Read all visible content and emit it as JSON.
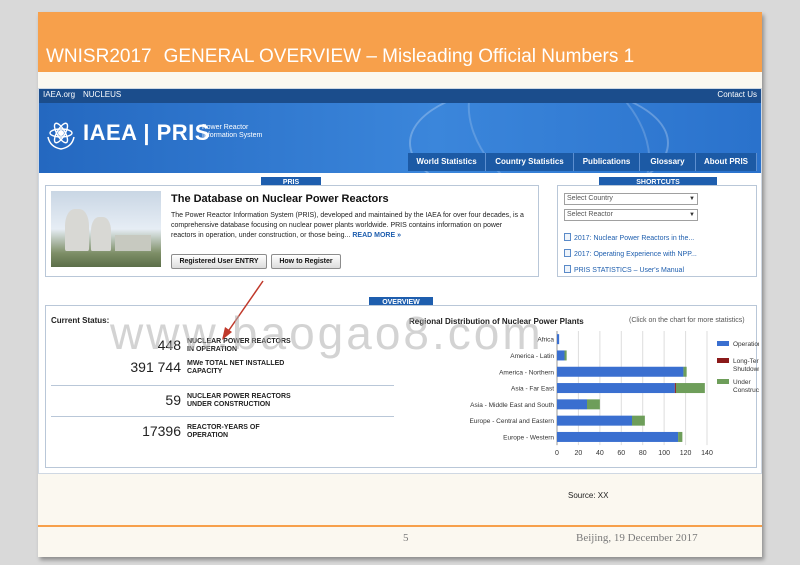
{
  "slide": {
    "code": "WNISR2017",
    "title": "GENERAL OVERVIEW – Misleading Official Numbers 1",
    "source": "Source: XX",
    "page": "5",
    "footer": "Beijing, 19 December 2017",
    "watermark": "www.baogao8.com",
    "accent_color": "#f7a04b"
  },
  "site": {
    "topnav": {
      "left1": "IAEA.org",
      "left2": "NUCLEUS",
      "right": "Contact Us"
    },
    "logo": {
      "text": "IAEA | PRIS",
      "subtitle": "Power Reactor Information System",
      "icon": "iaea-emblem-icon"
    },
    "menu": [
      "World Statistics",
      "Country Statistics",
      "Publications",
      "Glossary",
      "About PRIS"
    ],
    "brand_color": "#1e5eae"
  },
  "pris_panel": {
    "tab": "PRIS",
    "title": "The Database on Nuclear Power Reactors",
    "description": "The Power Reactor Information System (PRIS), developed and maintained by the IAEA for over four decades, is a comprehensive database focusing on nuclear power plants worldwide. PRIS contains information on power reactors in operation, under construction, or those being...",
    "read_more": "READ MORE »",
    "buttons": [
      "Registered User ENTRY",
      "How to Register"
    ]
  },
  "shortcuts": {
    "tab": "SHORTCUTS",
    "select_country": "Select Country",
    "select_reactor": "Select Reactor",
    "links": [
      "2017: Nuclear Power Reactors in the...",
      "2017: Operating Experience with NPP...",
      "PRIS STATISTICS – User's Manual"
    ]
  },
  "overview": {
    "tab": "OVERVIEW",
    "current_status": "Current Status:",
    "stats": [
      {
        "value": "448",
        "label1": "NUCLEAR POWER REACTORS",
        "label2": "IN OPERATION"
      },
      {
        "value": "391 744",
        "label1": "MWe TOTAL NET INSTALLED",
        "label2": "CAPACITY"
      },
      {
        "value": "59",
        "label1": "NUCLEAR POWER REACTORS",
        "label2": "UNDER CONSTRUCTION"
      },
      {
        "value": "17396",
        "label1": "REACTOR-YEARS OF",
        "label2": "OPERATION"
      }
    ]
  },
  "chart_data": {
    "type": "bar",
    "orientation": "horizontal",
    "stacked": true,
    "title": "Regional Distribution of Nuclear Power Plants",
    "subtitle": "(Click on the chart for more statistics)",
    "categories": [
      "Africa",
      "America - Latin",
      "America - Northern",
      "Asia - Far East",
      "Asia - Middle East and South",
      "Europe - Central and Eastern",
      "Europe - Western"
    ],
    "series": [
      {
        "name": "Operational",
        "color": "#3a6fd0",
        "values": [
          2,
          7,
          118,
          110,
          28,
          70,
          113
        ]
      },
      {
        "name": "Long-Term Shutdown",
        "color": "#8b1a1a",
        "values": [
          0,
          0,
          0,
          1,
          0,
          0,
          0
        ]
      },
      {
        "name": "Under Construction",
        "color": "#6e9e5a",
        "values": [
          0,
          2,
          3,
          27,
          12,
          12,
          4
        ]
      }
    ],
    "xticks": [
      0,
      20,
      40,
      60,
      80,
      100,
      120,
      140
    ],
    "xlim": [
      0,
      140
    ],
    "grid": true,
    "legend_placement": "right"
  }
}
